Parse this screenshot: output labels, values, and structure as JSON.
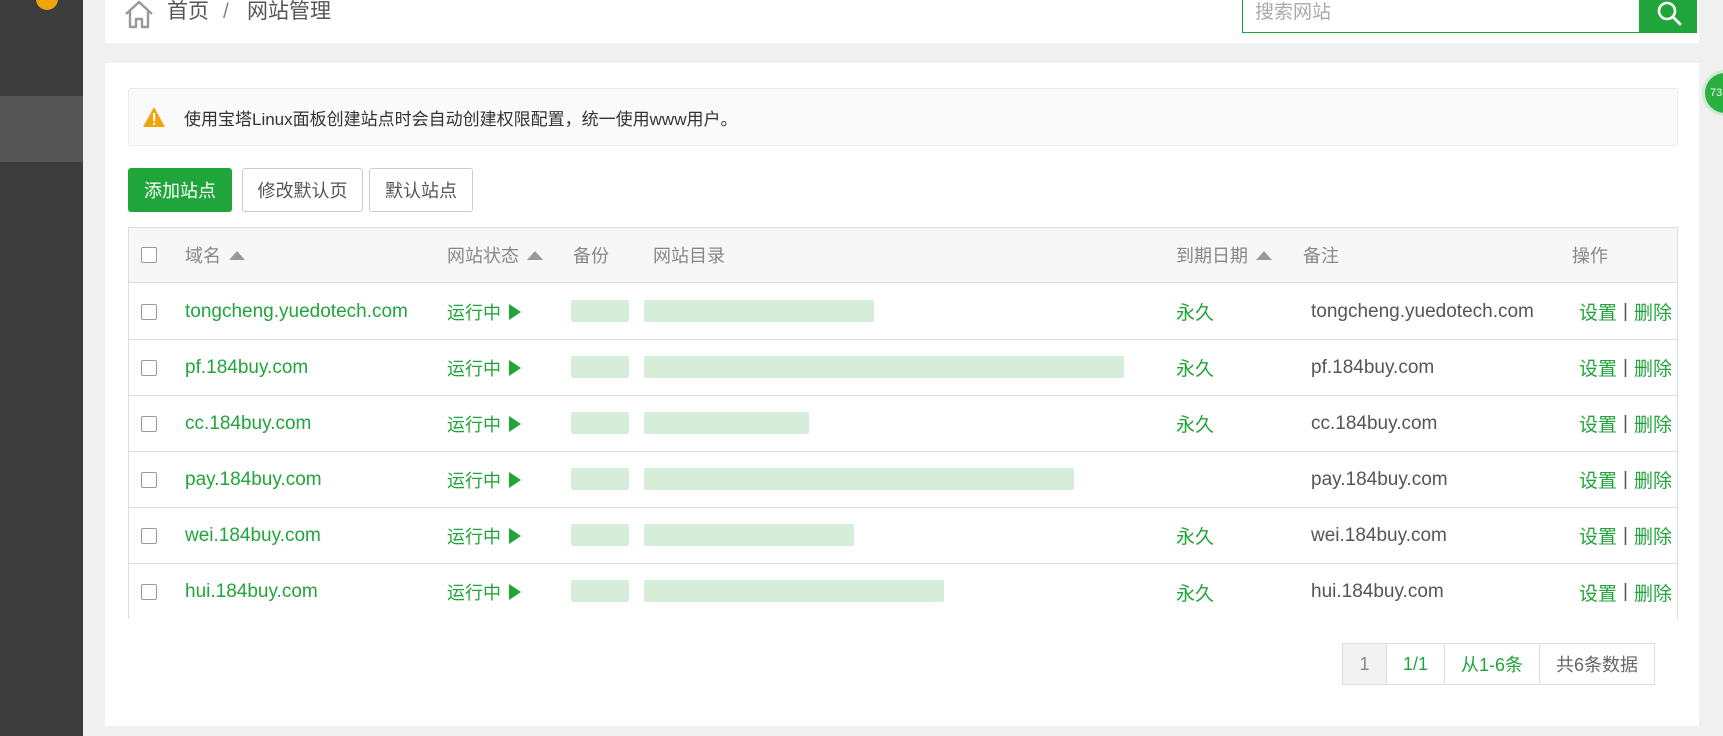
{
  "breadcrumb": {
    "home": "首页",
    "separator": "/",
    "current": "网站管理"
  },
  "search": {
    "placeholder": "搜索网站"
  },
  "alert": {
    "text": "使用宝塔Linux面板创建站点时会自动创建权限配置，统一使用www用户。"
  },
  "toolbar": {
    "add_site": "添加站点",
    "edit_default_page": "修改默认页",
    "default_site": "默认站点"
  },
  "table": {
    "headers": {
      "domain": "域名",
      "status": "网站状态",
      "backup": "备份",
      "directory": "网站目录",
      "expiry": "到期日期",
      "remark": "备注",
      "ops": "操作"
    },
    "rows": [
      {
        "domain": "tongcheng.yuedotech.com",
        "status": "运行中",
        "expiry": "永久",
        "remark": "tongcheng.yuedotech.com",
        "settings": "设置",
        "sep": "|",
        "delete": "删除"
      },
      {
        "domain": "pf.184buy.com",
        "status": "运行中",
        "expiry": "永久",
        "remark": "pf.184buy.com",
        "settings": "设置",
        "sep": "|",
        "delete": "删除"
      },
      {
        "domain": "cc.184buy.com",
        "status": "运行中",
        "expiry": "永久",
        "remark": "cc.184buy.com",
        "settings": "设置",
        "sep": "|",
        "delete": "删除"
      },
      {
        "domain": "pay.184buy.com",
        "status": "运行中",
        "expiry": "",
        "remark": "pay.184buy.com",
        "settings": "设置",
        "sep": "|",
        "delete": "删除"
      },
      {
        "domain": "wei.184buy.com",
        "status": "运行中",
        "expiry": "永久",
        "remark": "wei.184buy.com",
        "settings": "设置",
        "sep": "|",
        "delete": "删除"
      },
      {
        "domain": "hui.184buy.com",
        "status": "运行中",
        "expiry": "永久",
        "remark": "hui.184buy.com",
        "settings": "设置",
        "sep": "|",
        "delete": "删除"
      }
    ]
  },
  "pagination": {
    "current": "1",
    "total": "1/1",
    "range": "从1-6条",
    "count": "共6条数据"
  },
  "float_ball": {
    "text": "73"
  },
  "colors": {
    "brand": "#20a53a",
    "sidebar": "#3c3c3c",
    "warning": "#f0a30a"
  }
}
